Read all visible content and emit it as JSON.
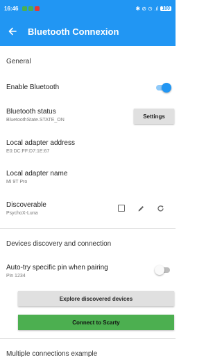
{
  "status_bar": {
    "time": "16:46",
    "right_text": "✱ ⊘ ⊙ .ıl",
    "battery": "100"
  },
  "app_bar": {
    "title": "Bluetooth Connexion",
    "back_icon": "arrow-back-icon"
  },
  "general": {
    "header": "General",
    "enable_bluetooth": {
      "label": "Enable Bluetooth",
      "on": true
    },
    "bluetooth_status": {
      "label": "Bluetooth status",
      "value": "BluetoothState.STATE_ON",
      "button": "Settings"
    },
    "adapter_address": {
      "label": "Local adapter address",
      "value": "E0:DC:FF:D7:1E:67"
    },
    "adapter_name": {
      "label": "Local adapter name",
      "value": "Mi 9T Pro"
    },
    "discoverable": {
      "label": "Discoverable",
      "value": "PsychoX-Luna",
      "icons": [
        "checkbox-icon",
        "edit-icon",
        "refresh-icon"
      ]
    }
  },
  "discovery": {
    "header": "Devices discovery and connection",
    "auto_pin": {
      "label": "Auto-try specific pin when pairing",
      "value": "Pin 1234",
      "on": false
    },
    "explore_button": "Explore discovered devices",
    "connect_button": "Connect to Scarty"
  },
  "multiple": {
    "header": "Multiple connections example"
  },
  "colors": {
    "primary": "#2196f3",
    "connect": "#4caf50",
    "button_grey": "#e0e0e0"
  }
}
